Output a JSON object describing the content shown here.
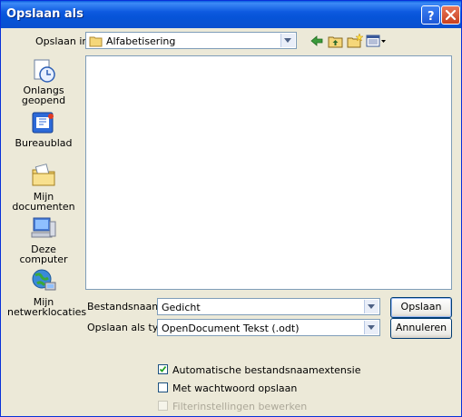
{
  "window": {
    "title": "Opslaan als"
  },
  "save_in": {
    "label": "Opslaan in:",
    "value": "Alfabetisering"
  },
  "places": [
    {
      "label_line1": "Onlangs",
      "label_line2": "geopend",
      "icon": "recent-documents-icon"
    },
    {
      "label_line1": "Bureaublad",
      "label_line2": "",
      "icon": "desktop-icon"
    },
    {
      "label_line1": "Mijn documenten",
      "label_line2": "",
      "icon": "my-documents-icon"
    },
    {
      "label_line1": "Deze computer",
      "label_line2": "",
      "icon": "my-computer-icon"
    },
    {
      "label_line1": "Mijn",
      "label_line2": "netwerklocaties",
      "icon": "network-places-icon"
    }
  ],
  "filename": {
    "label": "Bestandsnaam:",
    "value": "Gedicht"
  },
  "filetype": {
    "label": "Opslaan als type:",
    "value": "OpenDocument Tekst (.odt)"
  },
  "buttons": {
    "save": "Opslaan",
    "cancel": "Annuleren"
  },
  "options": [
    {
      "label": "Automatische bestandsnaamextensie",
      "checked": true,
      "enabled": true
    },
    {
      "label": "Met wachtwoord opslaan",
      "checked": false,
      "enabled": true
    },
    {
      "label": "Filterinstellingen bewerken",
      "checked": false,
      "enabled": false
    }
  ],
  "colors": {
    "titlebar": "#0a5fe0",
    "dialog_bg": "#ece9d8",
    "field_border": "#7f9db9"
  }
}
